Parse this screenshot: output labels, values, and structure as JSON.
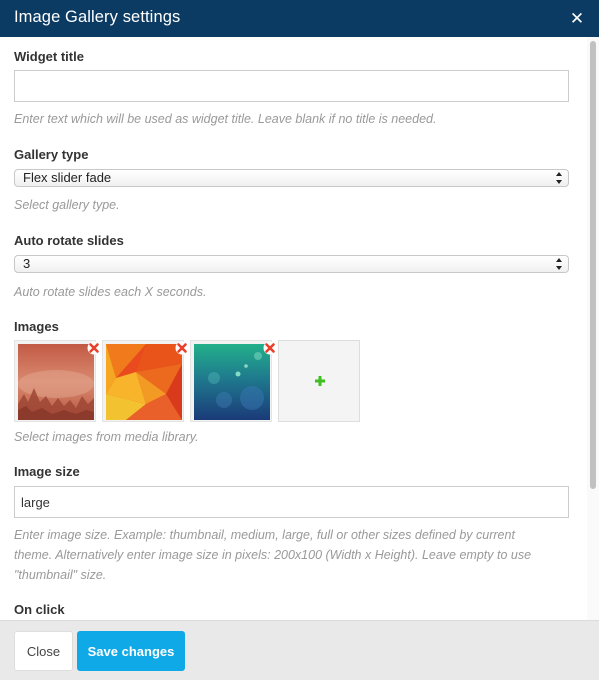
{
  "dialog": {
    "title": "Image Gallery settings",
    "close_icon": "close-icon"
  },
  "fields": {
    "widget_title": {
      "label": "Widget title",
      "value": "",
      "help": "Enter text which will be used as widget title. Leave blank if no title is needed."
    },
    "gallery_type": {
      "label": "Gallery type",
      "selected": "Flex slider fade",
      "help": "Select gallery type."
    },
    "auto_rotate": {
      "label": "Auto rotate slides",
      "selected": "3",
      "help": "Auto rotate slides each X seconds."
    },
    "images": {
      "label": "Images",
      "items": [
        {
          "name": "image-1",
          "palette": "red-forest"
        },
        {
          "name": "image-2",
          "palette": "orange-polygon"
        },
        {
          "name": "image-3",
          "palette": "teal-bokeh"
        }
      ],
      "help": "Select images from media library."
    },
    "image_size": {
      "label": "Image size",
      "value": "large",
      "help_line1": "Enter image size. Example: thumbnail, medium, large, full or other sizes defined by current",
      "help_line2": "theme. Alternatively enter image size in pixels: 200x100 (Width x Height). Leave empty to use",
      "help_line3": "\"thumbnail\" size."
    },
    "on_click": {
      "label": "On click"
    }
  },
  "footer": {
    "close_label": "Close",
    "save_label": "Save changes"
  },
  "colors": {
    "header_bg": "#0b3a63",
    "save_button": "#0ea9e6",
    "remove_icon": "#e8402a",
    "add_icon": "#3fbf1f"
  }
}
